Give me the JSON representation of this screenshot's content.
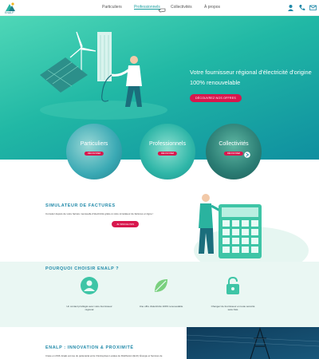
{
  "brand": {
    "name": "ENALP"
  },
  "nav": {
    "items": [
      {
        "label": "Particuliers"
      },
      {
        "label": "Professionnels"
      },
      {
        "label": "Collectivités"
      },
      {
        "label": "À propos"
      }
    ]
  },
  "hero": {
    "title": "Votre fournisseur régional d'électricité d'origine 100% renouvelable",
    "cta": "DÉCOUVREZ NOS OFFRES"
  },
  "audiences": [
    {
      "label": "Particuliers",
      "cta": "DÉCOUVREZ"
    },
    {
      "label": "Professionnels",
      "cta": "DÉCOUVREZ"
    },
    {
      "label": "Collectivités",
      "cta": "DÉCOUVREZ"
    }
  ],
  "simulator": {
    "title": "SIMULATEUR DE FACTURES",
    "text": "Cumulez depuis de votre facture mensuelle d'électricité grâce à notre simulateur de factures en ligne !",
    "cta": "JE SIMULE PAS"
  },
  "why": {
    "title": "POURQUOI CHOISIR ENALP ?",
    "features": [
      {
        "text": "Un contact privilégié avec votre fournisseur régional",
        "icon": "contact-person-icon"
      },
      {
        "text": "Une offre d'électricité 100% renouvelable",
        "icon": "leaf-icon"
      },
      {
        "text": "Changez de fournisseur en toute sécurité sans frais",
        "icon": "padlock-icon"
      }
    ]
  },
  "innovation": {
    "title": "ENALP : INNOVATION & PROXIMITÉ",
    "text": "Créée en 2016, Enalp est née du partenariat entre 3 Entreprises Locales de Distribution (ELD): Énergie et Services de"
  },
  "colors": {
    "accent": "#d8174d",
    "teal": "#21b8a5",
    "heading": "#1e88a8"
  }
}
